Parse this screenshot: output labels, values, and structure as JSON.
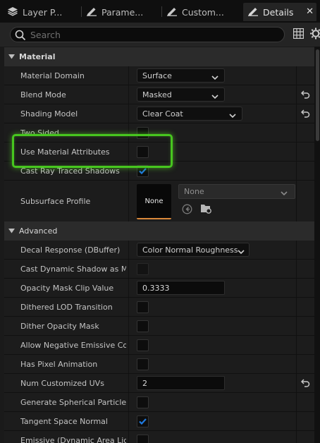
{
  "tabs": [
    {
      "label": "Layer P...",
      "icon": "layers-icon"
    },
    {
      "label": "Parame...",
      "icon": "pencil-icon"
    },
    {
      "label": "Custom...",
      "icon": "pencil-icon"
    },
    {
      "label": "Details",
      "icon": "pencil-icon",
      "active": true
    }
  ],
  "search": {
    "placeholder": "Search",
    "value": ""
  },
  "sections": {
    "material": "Material",
    "advanced": "Advanced"
  },
  "material": {
    "material_domain": {
      "label": "Material Domain",
      "value": "Surface"
    },
    "blend_mode": {
      "label": "Blend Mode",
      "value": "Masked"
    },
    "shading_model": {
      "label": "Shading Model",
      "value": "Clear Coat"
    },
    "two_sided": {
      "label": "Two Sided",
      "checked": false
    },
    "use_material_attributes": {
      "label": "Use Material Attributes",
      "checked": false
    },
    "cast_ray_traced_shadows": {
      "label": "Cast Ray Traced Shadows",
      "checked": true
    },
    "subsurface_profile": {
      "label": "Subsurface Profile",
      "thumb": "None",
      "value": "None"
    }
  },
  "advanced": {
    "decal_response": {
      "label": "Decal Response (DBuffer)",
      "value": "Color Normal Roughness"
    },
    "cast_dynamic_shadow": {
      "label": "Cast Dynamic Shadow as M...",
      "checked": false
    },
    "opacity_mask_clip": {
      "label": "Opacity Mask Clip Value",
      "value": "0.3333"
    },
    "dithered_lod": {
      "label": "Dithered LOD Transition",
      "checked": false
    },
    "dither_opacity": {
      "label": "Dither Opacity Mask",
      "checked": false
    },
    "allow_negative": {
      "label": "Allow Negative Emissive Color",
      "checked": false
    },
    "pixel_animation": {
      "label": "Has Pixel Animation",
      "checked": false
    },
    "num_uvs": {
      "label": "Num Customized UVs",
      "value": "2"
    },
    "spherical_particle": {
      "label": "Generate Spherical Particle...",
      "checked": false
    },
    "tangent_space": {
      "label": "Tangent Space Normal",
      "checked": true
    },
    "emissive_dynamic": {
      "label": "Emissive (Dynamic Area Lig...",
      "checked": false
    }
  },
  "colors": {
    "accent": "#1f7ae0",
    "highlight": "#47c61f",
    "thumb_underline": "#d9883a"
  }
}
